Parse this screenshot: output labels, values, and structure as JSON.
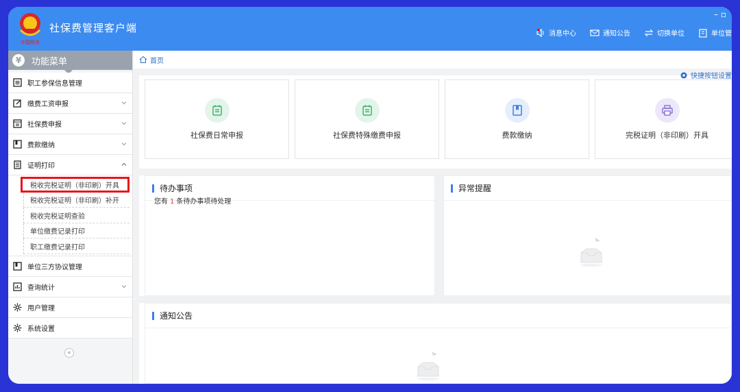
{
  "app": {
    "title": "社保费管理客户端"
  },
  "top_actions": [
    {
      "label": "消息中心",
      "icon": "bell-icon"
    },
    {
      "label": "通知公告",
      "icon": "mail-icon"
    },
    {
      "label": "切换单位",
      "icon": "switch-icon"
    },
    {
      "label": "单位管",
      "icon": "building-icon"
    }
  ],
  "sidebar": {
    "title": "功能菜单",
    "items": [
      {
        "label": "职工参保信息管理",
        "icon": "list-icon",
        "expandable": false
      },
      {
        "label": "缴费工资申报",
        "icon": "edit-icon",
        "expandable": true
      },
      {
        "label": "社保费申报",
        "icon": "form-icon",
        "expandable": true
      },
      {
        "label": "费款缴纳",
        "icon": "card-icon",
        "expandable": true
      },
      {
        "label": "证明打印",
        "icon": "print-doc-icon",
        "expandable": true,
        "expanded": true,
        "children": [
          {
            "label": "税收完税证明（非印刷）开具",
            "active": true
          },
          {
            "label": "税收完税证明（非印刷）补开"
          },
          {
            "label": "税收完税证明查验"
          },
          {
            "label": "单位缴费记录打印"
          },
          {
            "label": "职工缴费记录打印"
          }
        ]
      },
      {
        "label": "单位三方协议管理",
        "icon": "bookmark-icon",
        "expandable": false
      },
      {
        "label": "查询统计",
        "icon": "chart-icon",
        "expandable": true
      },
      {
        "label": "用户管理",
        "icon": "gear-icon",
        "expandable": false
      },
      {
        "label": "系统设置",
        "icon": "gear-icon",
        "expandable": false
      }
    ],
    "collapse_label": "«"
  },
  "breadcrumb": {
    "home": "首页"
  },
  "quick_settings": "快捷按钮设置",
  "cards": [
    {
      "label": "社保费日常申报",
      "icon": "calendar-list-icon",
      "color": "#3cb371",
      "bg": "#e3f5ea"
    },
    {
      "label": "社保费特殊缴费申报",
      "icon": "calendar-list-icon",
      "color": "#3cb371",
      "bg": "#e3f5ea"
    },
    {
      "label": "费款缴纳",
      "icon": "book-icon",
      "color": "#3c7ee8",
      "bg": "#e4eefc"
    },
    {
      "label": "完税证明（非印刷）开具",
      "icon": "printer-icon",
      "color": "#8a6fd6",
      "bg": "#ece7fa"
    }
  ],
  "panels": {
    "todo": {
      "title": "待办事项",
      "prefix": "您有",
      "count": "1",
      "suffix": "条待办事项待处理"
    },
    "alert": {
      "title": "异常提醒"
    },
    "notice": {
      "title": "通知公告"
    }
  },
  "colors": {
    "topbar": "#3c8bf0",
    "accent": "#3c7ee8",
    "highlight": "#e8141b"
  }
}
